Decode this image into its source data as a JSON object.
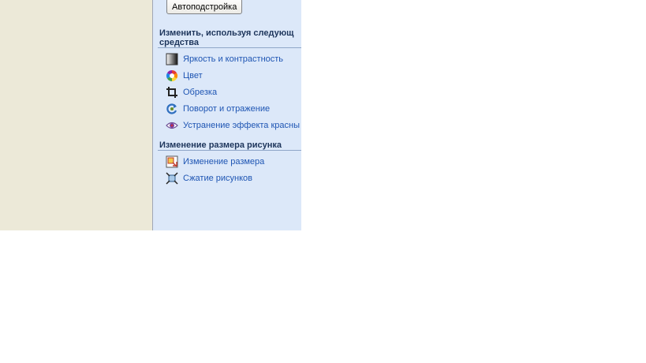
{
  "autoadjust_button": {
    "label": "Автоподстройка"
  },
  "section_edit": {
    "title_line1": "Изменить, используя следующ",
    "title_line2": "средства",
    "items": [
      {
        "label": "Яркость и контрастность",
        "icon": "brightness-contrast-icon"
      },
      {
        "label": "Цвет",
        "icon": "color-wheel-icon"
      },
      {
        "label": "Обрезка",
        "icon": "crop-icon"
      },
      {
        "label": "Поворот и отражение",
        "icon": "rotate-flip-icon"
      },
      {
        "label": "Устранение эффекта красны",
        "icon": "red-eye-icon"
      }
    ]
  },
  "section_resize": {
    "title": "Изменение размера рисунка",
    "items": [
      {
        "label": "Изменение размера",
        "icon": "resize-icon"
      },
      {
        "label": "Сжатие рисунков",
        "icon": "compress-icon"
      }
    ]
  },
  "colors": {
    "left_pane": "#ECE9D8",
    "task_pane": "#DCE8F9",
    "section_title": "#1D355B",
    "link": "#1E55B3"
  }
}
